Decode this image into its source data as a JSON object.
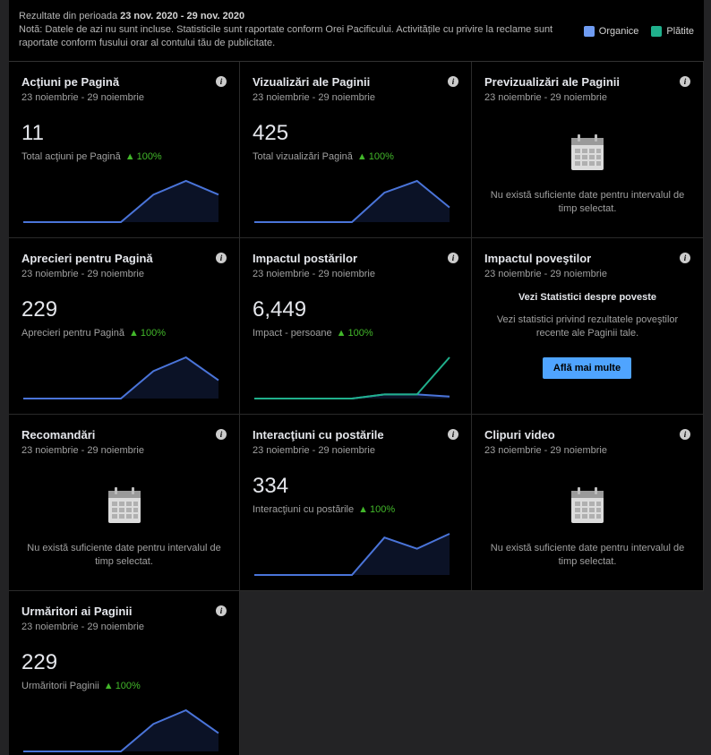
{
  "header": {
    "period_label": "Rezultate din perioada",
    "period_range": "23 nov. 2020 - 29 nov. 2020",
    "note_label": "Notă:",
    "note_text": "Datele de azi nu sunt incluse. Statisticile sunt raportate conform Orei Pacificului. Activitățile cu privire la reclame sunt raportate conform fusului orar al contului tău de publicitate."
  },
  "legend": [
    {
      "label": "Organice",
      "color": "#6f9cf2"
    },
    {
      "label": "Plătite",
      "color": "#20b08c"
    }
  ],
  "date_range": "23 noiembrie - 29 noiembrie",
  "cards": {
    "actiuni": {
      "title": "Acţiuni pe Pagină",
      "value": "11",
      "sub": "Total acţiuni pe Pagină",
      "change": "100%"
    },
    "vizualizari": {
      "title": "Vizualizări ale Paginii",
      "value": "425",
      "sub": "Total vizualizări Pagină",
      "change": "100%"
    },
    "previzualizari": {
      "title": "Previzualizări ale Paginii",
      "nodata": "Nu există suficiente date pentru intervalul de timp selectat."
    },
    "aprecieri": {
      "title": "Aprecieri pentru Pagină",
      "value": "229",
      "sub": "Aprecieri pentru Pagină",
      "change": "100%"
    },
    "impact": {
      "title": "Impactul postărilor",
      "value": "6,449",
      "sub": "Impact - persoane",
      "change": "100%"
    },
    "povesti": {
      "title": "Impactul poveştilor",
      "heading": "Vezi Statistici despre poveste",
      "text": "Vezi statistici privind rezultatele poveştilor recente ale Paginii tale.",
      "button": "Află mai multe"
    },
    "recomandari": {
      "title": "Recomandări",
      "nodata": "Nu există suficiente date pentru intervalul de timp selectat."
    },
    "interactiuni": {
      "title": "Interacţiuni cu postările",
      "value": "334",
      "sub": "Interacţiuni cu postările",
      "change": "100%"
    },
    "clipuri": {
      "title": "Clipuri video",
      "nodata": "Nu există suficiente date pentru intervalul de timp selectat."
    },
    "urmaritori": {
      "title": "Urmăritori ai Paginii",
      "value": "229",
      "sub": "Urmăritorii Paginii",
      "change": "100%"
    }
  },
  "sparklines": {
    "actiuni": {
      "organic": [
        0,
        0,
        0,
        0,
        1,
        1.5,
        1
      ]
    },
    "vizualizari": {
      "organic": [
        0,
        0,
        0,
        0,
        1,
        1.4,
        0.5
      ]
    },
    "aprecieri": {
      "organic": [
        0,
        0,
        0,
        0,
        0.6,
        0.9,
        0.4
      ]
    },
    "impact": {
      "organic": [
        0,
        0,
        0,
        0,
        0.1,
        0.1,
        0.05
      ],
      "paid": [
        0,
        0,
        0,
        0,
        0.1,
        0.1,
        1
      ]
    },
    "interactiuni": {
      "organic": [
        0,
        0,
        0,
        0,
        1,
        0.7,
        1.1
      ]
    },
    "urmaritori": {
      "organic": [
        0,
        0,
        0,
        0,
        0.6,
        0.9,
        0.4
      ]
    }
  },
  "colors": {
    "organic": "#4a74d9",
    "paid": "#20b08c",
    "positive": "#42b72a"
  }
}
